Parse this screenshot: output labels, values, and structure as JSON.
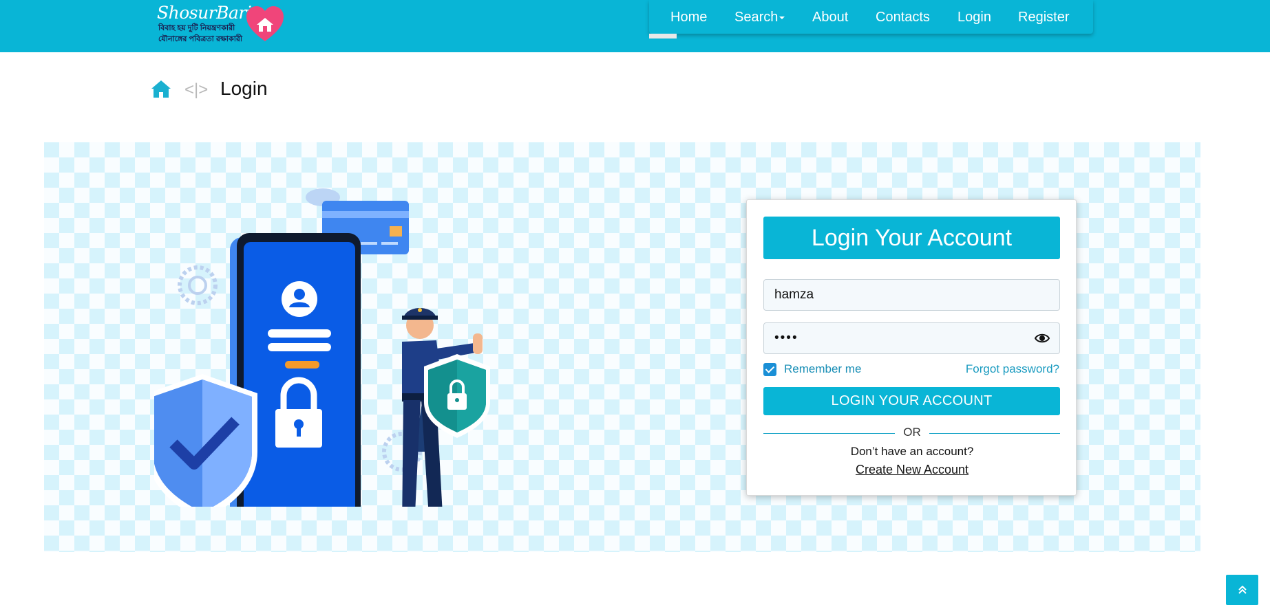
{
  "header": {
    "logo": {
      "name": "ShosurBari",
      "tagline_line1": "বিবাহ হয় দুটি নিয়ন্ত্রণকারী",
      "tagline_line2": "যৌনাঙ্গের পবিত্রতা রক্ষাকারী"
    },
    "nav": [
      {
        "label": "Home"
      },
      {
        "label": "Search"
      },
      {
        "label": "About"
      },
      {
        "label": "Contacts"
      },
      {
        "label": "Login"
      },
      {
        "label": "Register"
      }
    ]
  },
  "breadcrumb": {
    "separator": "<|>",
    "current": "Login"
  },
  "login_form": {
    "heading": "Login Your Account",
    "username_value": "hamza",
    "password_value": "••••",
    "remember_label": "Remember me",
    "remember_checked": true,
    "forgot_label": "Forgot password?",
    "submit_label": "LOGIN YOUR ACCOUNT",
    "or_label": "OR",
    "no_account_text": "Don’t have an account?",
    "create_account_label": "Create New Account"
  },
  "colors": {
    "primary": "#09b5d6",
    "banner_bg": "#d6f3fc",
    "checkbox": "#1a8fd6"
  },
  "icons": [
    "home-icon",
    "heart-house-logo-icon",
    "eye-icon",
    "angles-up-icon",
    "shield-check-icon",
    "padlock-icon",
    "user-icon"
  ]
}
